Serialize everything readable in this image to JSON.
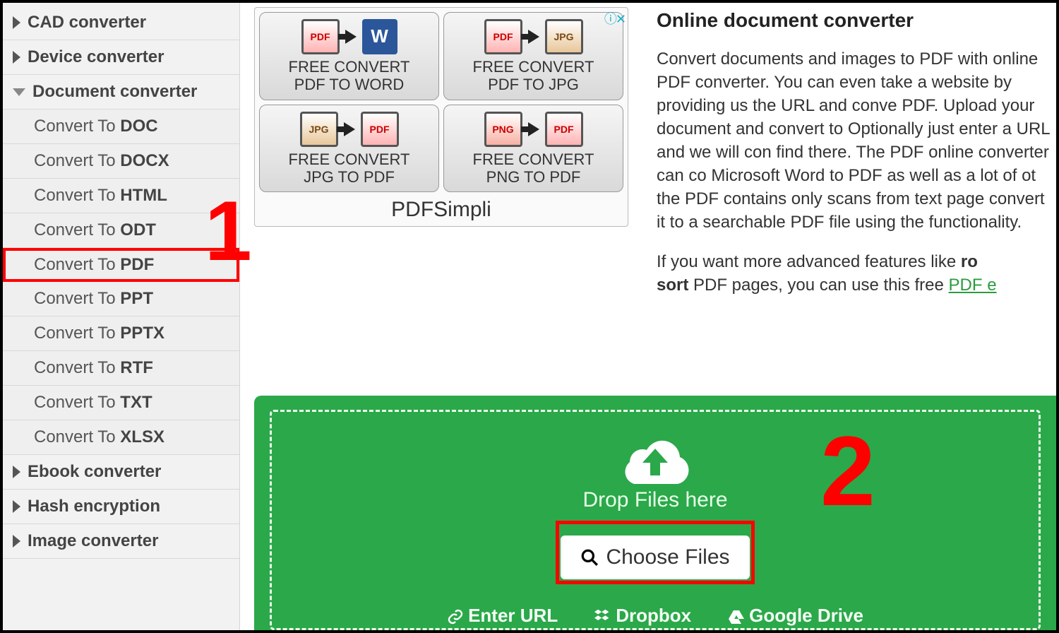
{
  "sidebar": {
    "cats": [
      {
        "label": "CAD converter"
      },
      {
        "label": "Device converter"
      },
      {
        "label": "Document converter"
      },
      {
        "label": "Ebook converter"
      },
      {
        "label": "Hash encryption"
      },
      {
        "label": "Image converter"
      }
    ],
    "subs": [
      {
        "pre": "Convert To ",
        "fmt": "DOC"
      },
      {
        "pre": "Convert To ",
        "fmt": "DOCX"
      },
      {
        "pre": "Convert To ",
        "fmt": "HTML"
      },
      {
        "pre": "Convert To ",
        "fmt": "ODT"
      },
      {
        "pre": "Convert To ",
        "fmt": "PDF"
      },
      {
        "pre": "Convert To ",
        "fmt": "PPT"
      },
      {
        "pre": "Convert To ",
        "fmt": "PPTX"
      },
      {
        "pre": "Convert To ",
        "fmt": "RTF"
      },
      {
        "pre": "Convert To ",
        "fmt": "TXT"
      },
      {
        "pre": "Convert To ",
        "fmt": "XLSX"
      }
    ]
  },
  "ad": {
    "cells": [
      {
        "l1": "FREE CONVERT",
        "l2": "PDF TO WORD"
      },
      {
        "l1": "FREE CONVERT",
        "l2": "PDF TO JPG"
      },
      {
        "l1": "FREE CONVERT",
        "l2": "JPG TO PDF"
      },
      {
        "l1": "FREE CONVERT",
        "l2": "PNG TO PDF"
      }
    ],
    "icons": {
      "pdf": "PDF",
      "jpg": "JPG",
      "png": "PNG",
      "word": "W"
    },
    "caption": "PDFSimpli"
  },
  "desc": {
    "title": "Online document converter",
    "p1": "Convert documents and images to PDF with online PDF converter. You can even take a website by providing us the URL and conve PDF. Upload your document and convert to Optionally just enter a URL and we will con find there. The PDF online converter can co Microsoft Word to PDF as well as a lot of ot the PDF contains only scans from text page convert it to a searchable PDF file using the functionality.",
    "p2a": "If you want more advanced features like ",
    "p2b": "ro",
    "p2c": "sort",
    "p2d": " PDF pages, you can use this free ",
    "p2link": "PDF e"
  },
  "upload": {
    "drop": "Drop Files here",
    "choose": "Choose Files",
    "subs": [
      "Enter URL",
      "Dropbox",
      "Google Drive"
    ]
  },
  "annot": {
    "one": "1",
    "two": "2"
  }
}
